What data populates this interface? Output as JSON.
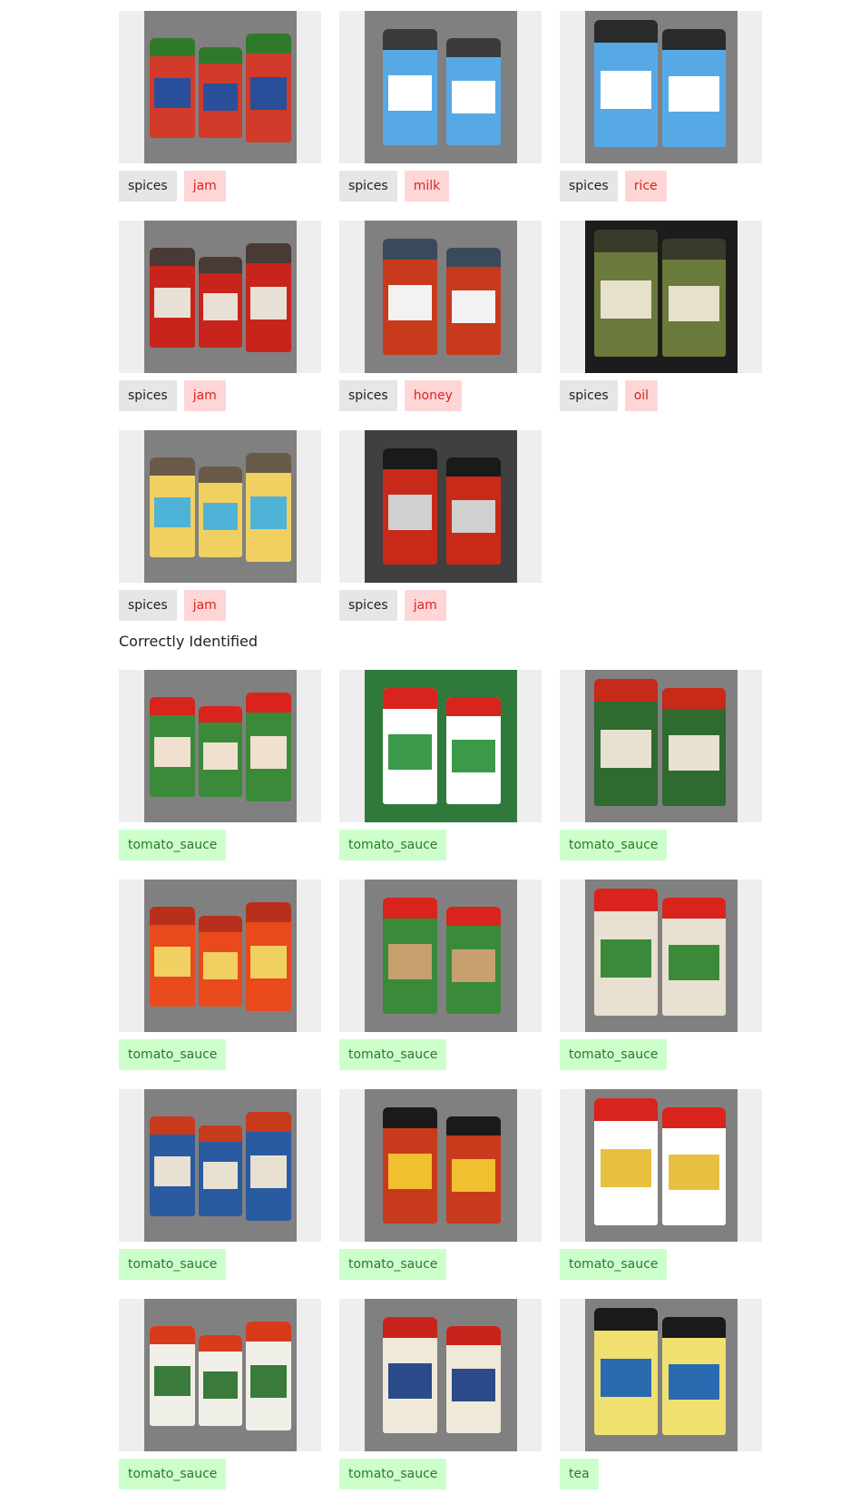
{
  "misclassified": [
    {
      "pred": "spices",
      "label": "jam",
      "colors": {
        "bg": "#808080",
        "a": "#2f7a2a",
        "b": "#d23a2a",
        "c": "#2a4f9a"
      }
    },
    {
      "pred": "spices",
      "label": "milk",
      "colors": {
        "bg": "#808080",
        "a": "#3b3b3b",
        "b": "#57a9e6",
        "c": "#ffffff"
      }
    },
    {
      "pred": "spices",
      "label": "rice",
      "colors": {
        "bg": "#808080",
        "a": "#2a2a2a",
        "b": "#57a9e6",
        "c": "#ffffff"
      }
    },
    {
      "pred": "spices",
      "label": "jam",
      "colors": {
        "bg": "#808080",
        "a": "#4a3a35",
        "b": "#c8241c",
        "c": "#e9e0d5"
      }
    },
    {
      "pred": "spices",
      "label": "honey",
      "colors": {
        "bg": "#808080",
        "a": "#3a4a5a",
        "b": "#c83a1c",
        "c": "#f2f2f2"
      }
    },
    {
      "pred": "spices",
      "label": "oil",
      "colors": {
        "bg": "#1c1c1c",
        "a": "#3a3a2a",
        "b": "#6a7a3a",
        "c": "#e6e0cc"
      }
    },
    {
      "pred": "spices",
      "label": "jam",
      "colors": {
        "bg": "#808080",
        "a": "#6a5a4a",
        "b": "#f0d060",
        "c": "#4fb3d8"
      }
    },
    {
      "pred": "spices",
      "label": "jam",
      "colors": {
        "bg": "#404040",
        "a": "#1a1a1a",
        "b": "#c82a1a",
        "c": "#d0d0d0"
      }
    }
  ],
  "section_title": "Correctly Identified",
  "correct": [
    {
      "label": "tomato_sauce",
      "colors": {
        "bg": "#808080",
        "a": "#d8241c",
        "b": "#3a8a3a",
        "c": "#f0e0d0"
      }
    },
    {
      "label": "tomato_sauce",
      "colors": {
        "bg": "#2f7a3a",
        "a": "#d8241c",
        "b": "#ffffff",
        "c": "#3a9a4a"
      }
    },
    {
      "label": "tomato_sauce",
      "colors": {
        "bg": "#808080",
        "a": "#c82a1a",
        "b": "#2f6a2f",
        "c": "#e8e0d0"
      }
    },
    {
      "label": "tomato_sauce",
      "colors": {
        "bg": "#808080",
        "a": "#b8301c",
        "b": "#e84a1c",
        "c": "#f0d060"
      }
    },
    {
      "label": "tomato_sauce",
      "colors": {
        "bg": "#808080",
        "a": "#d8241c",
        "b": "#3a8a3a",
        "c": "#c8a070"
      }
    },
    {
      "label": "tomato_sauce",
      "colors": {
        "bg": "#808080",
        "a": "#d8241c",
        "b": "#e8e0d0",
        "c": "#3a8a3a"
      }
    },
    {
      "label": "tomato_sauce",
      "colors": {
        "bg": "#808080",
        "a": "#c83a1c",
        "b": "#2a5aa0",
        "c": "#e8e0d0"
      }
    },
    {
      "label": "tomato_sauce",
      "colors": {
        "bg": "#808080",
        "a": "#1a1a1a",
        "b": "#c83a1c",
        "c": "#f0c030"
      }
    },
    {
      "label": "tomato_sauce",
      "colors": {
        "bg": "#808080",
        "a": "#d8241c",
        "b": "#ffffff",
        "c": "#e8c040"
      }
    },
    {
      "label": "tomato_sauce",
      "colors": {
        "bg": "#808080",
        "a": "#d83a1c",
        "b": "#f0f0e8",
        "c": "#3a7a3a"
      }
    },
    {
      "label": "tomato_sauce",
      "colors": {
        "bg": "#808080",
        "a": "#c8241c",
        "b": "#f0e8d8",
        "c": "#2a4a8a"
      }
    },
    {
      "label": "tea",
      "colors": {
        "bg": "#808080",
        "a": "#1a1a1a",
        "b": "#f0e070",
        "c": "#2a6ab0"
      }
    }
  ]
}
